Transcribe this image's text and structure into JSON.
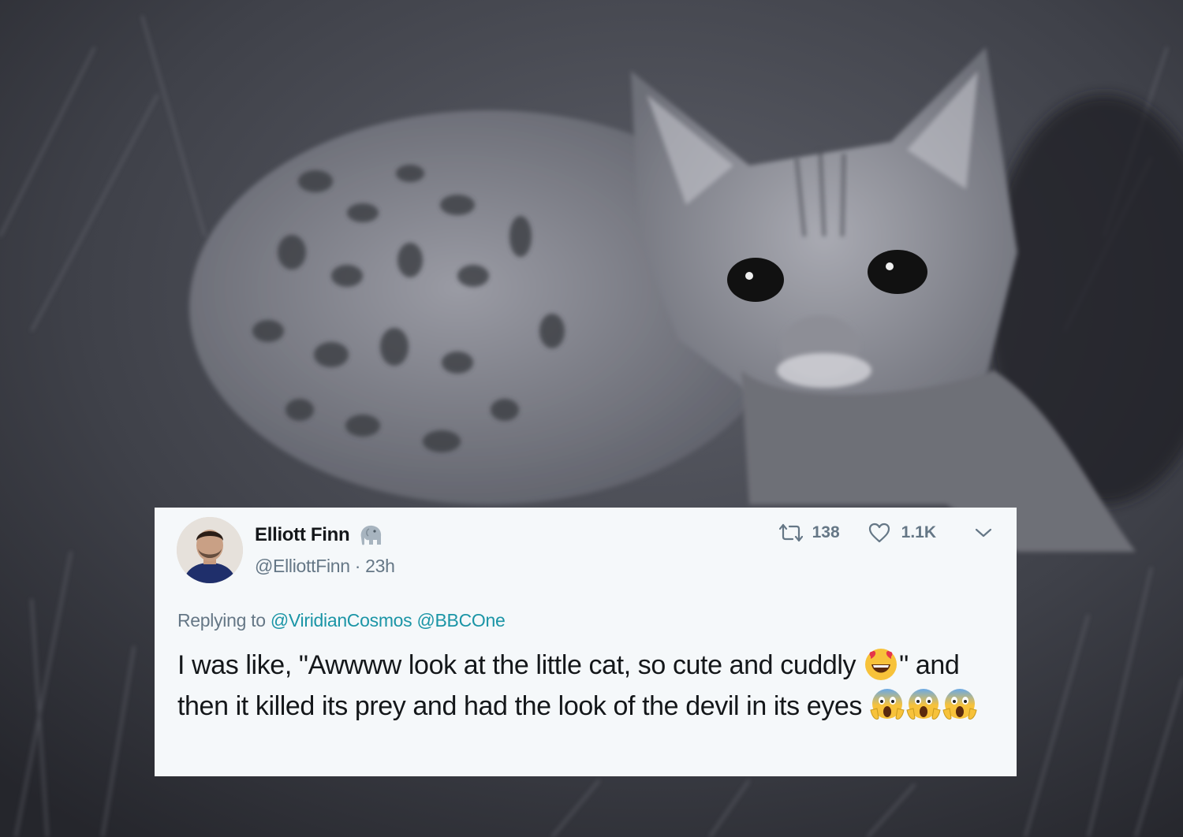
{
  "tweet": {
    "display_name": "Elliott Finn",
    "handle": "@ElliottFinn",
    "separator": "·",
    "time": "23h",
    "verified_icon": "elephant-icon",
    "retweet_count": "138",
    "like_count": "1.1K",
    "replying_label": "Replying to",
    "mentions": [
      "@ViridianCosmos",
      "@BBCOne"
    ],
    "text_part1": "I was like, \"Awwww look at the little cat, so cute and cuddly",
    "text_part2": "\" and then it killed its prey and had the look of the devil in its eyes",
    "emojis": [
      "heart-eyes-emoji",
      "scream-emoji",
      "scream-emoji",
      "scream-emoji"
    ]
  },
  "icons": {
    "retweet": "retweet-icon",
    "like": "heart-icon",
    "menu": "chevron-down-icon"
  },
  "colors": {
    "card_background": "#f5f8fa",
    "text": "#14171a",
    "secondary_text": "#657786",
    "mention": "#1b95a6"
  }
}
